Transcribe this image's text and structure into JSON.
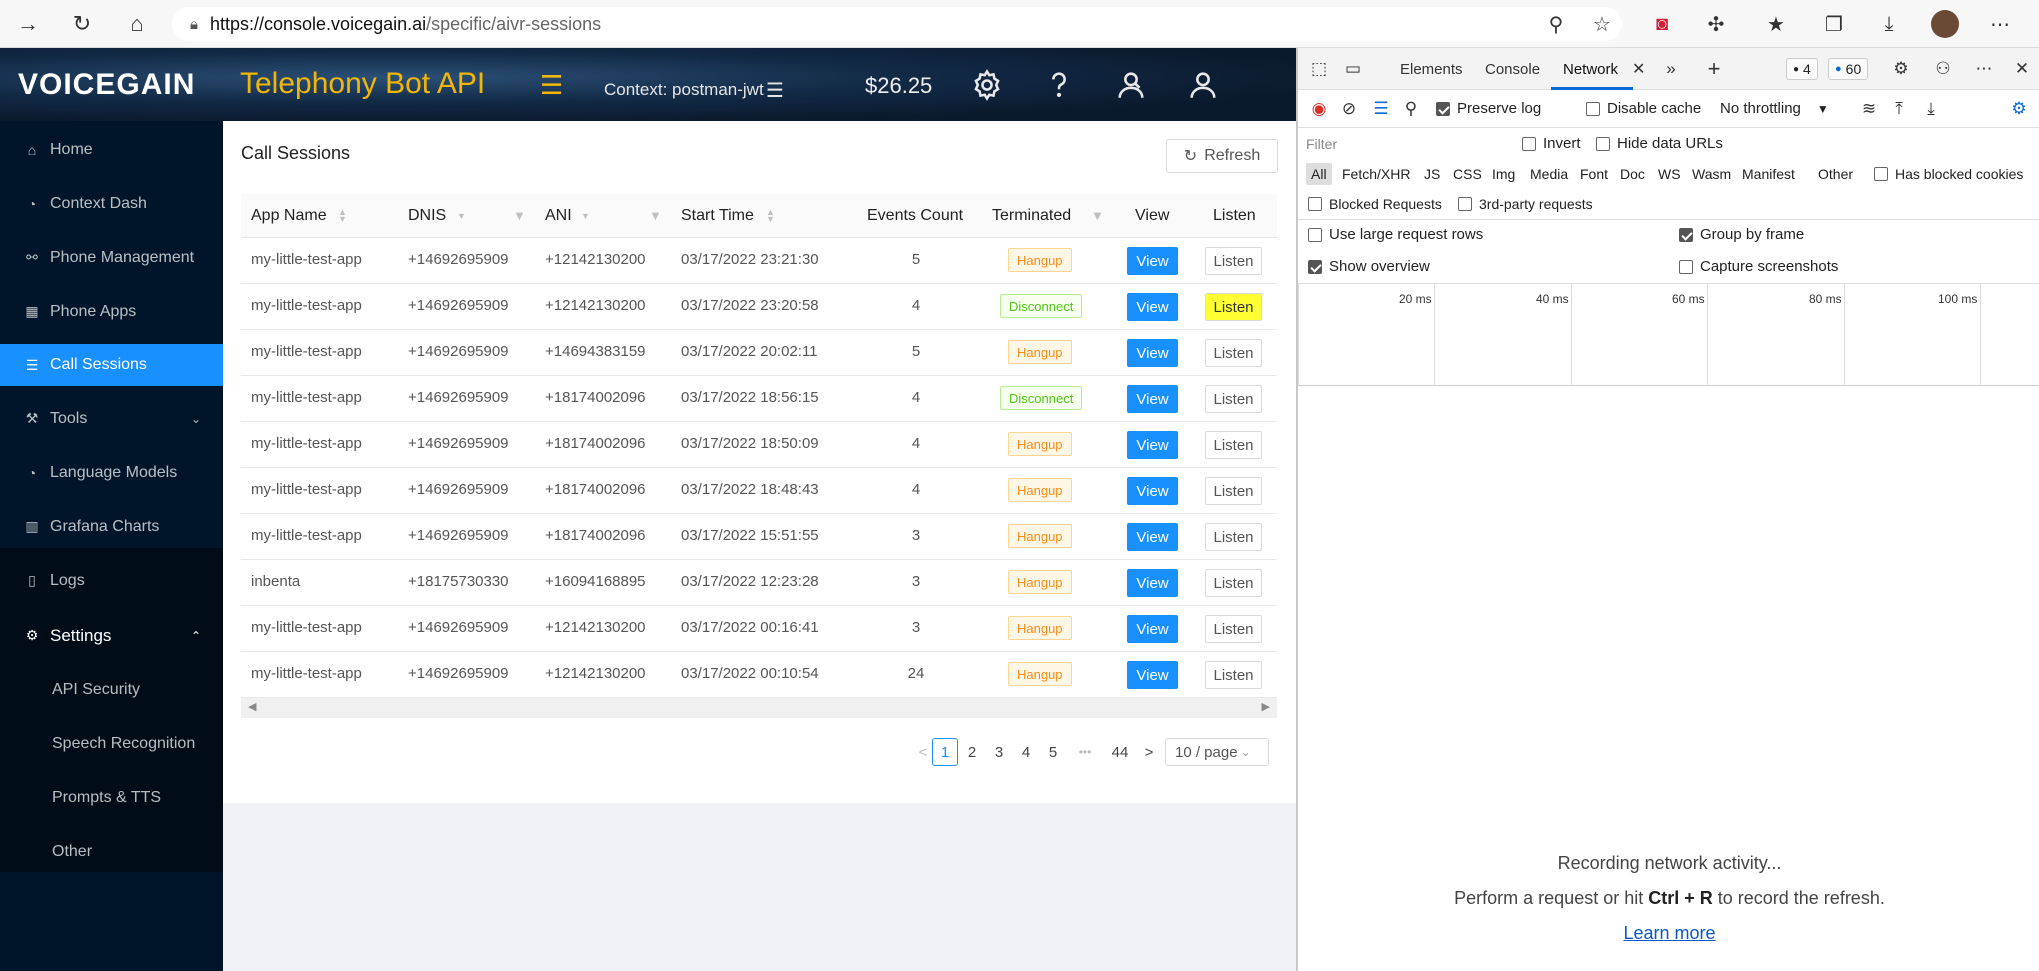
{
  "browser": {
    "url_host": "https://console.voicegain.ai",
    "url_path": "/specific/aivr-sessions"
  },
  "header": {
    "brand": "VOICEGAIN",
    "product": "Telephony Bot API",
    "context_label": "Context:  postman-jwt",
    "balance": "$26.25"
  },
  "sidebar": {
    "items": [
      {
        "label": "Home",
        "icon": "home-icon"
      },
      {
        "label": "Context Dash",
        "icon": "dashboard-icon"
      },
      {
        "label": "Phone Management",
        "icon": "link-icon"
      },
      {
        "label": "Phone Apps",
        "icon": "grid-icon"
      },
      {
        "label": "Call Sessions",
        "icon": "list-icon"
      },
      {
        "label": "Tools",
        "icon": "wrench-icon"
      },
      {
        "label": "Language Models",
        "icon": "dashboard-icon"
      },
      {
        "label": "Grafana Charts",
        "icon": "bar-chart-icon"
      },
      {
        "label": "Logs",
        "icon": "file-icon"
      },
      {
        "label": "Settings",
        "icon": "gear-icon"
      }
    ],
    "sub_items": [
      "API Security",
      "Speech Recognition",
      "Prompts & TTS",
      "Other"
    ]
  },
  "main": {
    "title": "Call Sessions",
    "refresh_label": "Refresh",
    "columns": [
      "App Name",
      "DNIS",
      "ANI",
      "Start Time",
      "Events Count",
      "Terminated",
      "View",
      "Listen"
    ],
    "view_label": "View",
    "listen_label": "Listen",
    "rows": [
      {
        "app": "my-little-test-app",
        "dnis": "+14692695909",
        "ani": "+12142130200",
        "start": "03/17/2022 23:21:30",
        "events": "5",
        "terminated": "Hangup"
      },
      {
        "app": "my-little-test-app",
        "dnis": "+14692695909",
        "ani": "+12142130200",
        "start": "03/17/2022 23:20:58",
        "events": "4",
        "terminated": "Disconnect"
      },
      {
        "app": "my-little-test-app",
        "dnis": "+14692695909",
        "ani": "+14694383159",
        "start": "03/17/2022 20:02:11",
        "events": "5",
        "terminated": "Hangup"
      },
      {
        "app": "my-little-test-app",
        "dnis": "+14692695909",
        "ani": "+18174002096",
        "start": "03/17/2022 18:56:15",
        "events": "4",
        "terminated": "Disconnect"
      },
      {
        "app": "my-little-test-app",
        "dnis": "+14692695909",
        "ani": "+18174002096",
        "start": "03/17/2022 18:50:09",
        "events": "4",
        "terminated": "Hangup"
      },
      {
        "app": "my-little-test-app",
        "dnis": "+14692695909",
        "ani": "+18174002096",
        "start": "03/17/2022 18:48:43",
        "events": "4",
        "terminated": "Hangup"
      },
      {
        "app": "my-little-test-app",
        "dnis": "+14692695909",
        "ani": "+18174002096",
        "start": "03/17/2022 15:51:55",
        "events": "3",
        "terminated": "Hangup"
      },
      {
        "app": "inbenta",
        "dnis": "+18175730330",
        "ani": "+16094168895",
        "start": "03/17/2022 12:23:28",
        "events": "3",
        "terminated": "Hangup"
      },
      {
        "app": "my-little-test-app",
        "dnis": "+14692695909",
        "ani": "+12142130200",
        "start": "03/17/2022 00:16:41",
        "events": "3",
        "terminated": "Hangup"
      },
      {
        "app": "my-little-test-app",
        "dnis": "+14692695909",
        "ani": "+12142130200",
        "start": "03/17/2022 00:10:54",
        "events": "24",
        "terminated": "Hangup"
      }
    ],
    "pagination": {
      "prev": "<",
      "pages": [
        "1",
        "2",
        "3",
        "4",
        "5"
      ],
      "ellipsis": "•••",
      "last": "44",
      "next": ">",
      "page_size": "10 / page"
    }
  },
  "devtools": {
    "tabs": [
      "Elements",
      "Console",
      "Network"
    ],
    "issues_count": "4",
    "messages_count": "60",
    "preserve_log": "Preserve log",
    "disable_cache": "Disable cache",
    "throttling": "No throttling",
    "filter_placeholder": "Filter",
    "invert": "Invert",
    "hide_data_urls": "Hide data URLs",
    "types": [
      "All",
      "Fetch/XHR",
      "JS",
      "CSS",
      "Img",
      "Media",
      "Font",
      "Doc",
      "WS",
      "Wasm",
      "Manifest",
      "Other"
    ],
    "has_blocked_cookies": "Has blocked cookies",
    "blocked_requests": "Blocked Requests",
    "third_party": "3rd-party requests",
    "large_rows": "Use large request rows",
    "group_by_frame": "Group by frame",
    "show_overview": "Show overview",
    "capture_screenshots": "Capture screenshots",
    "ticks": [
      "20 ms",
      "40 ms",
      "60 ms",
      "80 ms",
      "100 ms"
    ],
    "recording": "Recording network activity...",
    "hint_pre": "Perform a request or hit ",
    "hint_key": "Ctrl + R",
    "hint_post": " to record the refresh.",
    "learn_more": "Learn more"
  },
  "colors": {
    "accent": "#1890ff",
    "sidebar_bg": "#001529",
    "brand_yellow": "#f2b705",
    "hangup": "#fa8c16",
    "disconnect": "#52c41a",
    "highlight": "#ffff33"
  }
}
